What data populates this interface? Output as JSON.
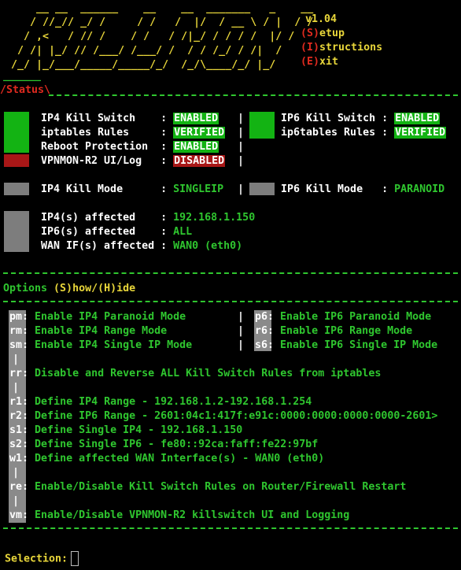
{
  "logo_art": "     __ __  ______    __    __  _______   _    __\n    / //_// _/ /     / /   /  |/  / __ \\ / |  / /\n   / ,<   / // /    / /   / /|_/ / / / /  |/ / \n  / /| |_/ // /___/ /___/ /  / / /_/ / /|  /  \n /_/ |_/___/_____/_____/_/  /_/\\____/_/ |_/   ",
  "menu": {
    "version": "v1.04",
    "setup_key": "(S)",
    "setup_label": "etup",
    "instr_key": "(I)",
    "instr_label": "structions",
    "exit_key": "(E)",
    "exit_label": "xit"
  },
  "status_underline": "______",
  "status_header": "/Status\\",
  "status": {
    "left": [
      {
        "label": "IP4 Kill Switch    :",
        "value": "ENABLED",
        "state": "green"
      },
      {
        "label": "iptables Rules     :",
        "value": "VERIFIED",
        "state": "green"
      },
      {
        "label": "Reboot Protection  :",
        "value": "ENABLED",
        "state": "green"
      },
      {
        "label": "VPNMON-R2 UI/Log   :",
        "value": "DISABLED",
        "state": "red"
      }
    ],
    "right": [
      {
        "label": "IP6 Kill Switch :",
        "value": "ENABLED",
        "state": "green"
      },
      {
        "label": "ip6tables Rules :",
        "value": "VERIFIED",
        "state": "green"
      }
    ],
    "ip4_mode_label": "IP4 Kill Mode      :",
    "ip4_mode_value": "SINGLEIP",
    "ip6_mode_label": "IP6 Kill Mode   :",
    "ip6_mode_value": "PARANOID",
    "affected": [
      {
        "label": "IP4(s) affected    :",
        "value": "192.168.1.150"
      },
      {
        "label": "IP6(s) affected    :",
        "value": "ALL"
      },
      {
        "label": "WAN IF(s) affected :",
        "value": "WAN0 (eth0)"
      }
    ]
  },
  "options_header": {
    "prefix": "Options ",
    "show": "(S)how/(H)ide"
  },
  "options": {
    "ip4": [
      {
        "key": "pm",
        "label": "Enable IP4 Paranoid Mode"
      },
      {
        "key": "rm",
        "label": "Enable IP4 Range Mode"
      },
      {
        "key": "sm",
        "label": "Enable IP4 Single IP Mode"
      }
    ],
    "ip6": [
      {
        "key": "p6",
        "label": "Enable IP6 Paranoid Mode"
      },
      {
        "key": "r6",
        "label": "Enable IP6 Range Mode"
      },
      {
        "key": "s6",
        "label": "Enable IP6 Single IP Mode"
      }
    ],
    "rr": {
      "key": "rr",
      "label": "Disable and Reverse ALL Kill Switch Rules from iptables"
    },
    "defines": [
      {
        "key": "r1",
        "label": "Define IP4 Range - 192.168.1.2-192.168.1.254"
      },
      {
        "key": "r2",
        "label": "Define IP6 Range - 2601:04c1:417f:e91c:0000:0000:0000:0000-2601>"
      },
      {
        "key": "s1",
        "label": "Define Single IP4 - 192.168.1.150"
      },
      {
        "key": "s2",
        "label": "Define Single IP6 - fe80::92ca:faff:fe22:97bf"
      },
      {
        "key": "w1",
        "label": "Define affected WAN Interface(s) - WAN0 (eth0)"
      }
    ],
    "re": {
      "key": "re",
      "label": "Enable/Disable Kill Switch Rules on Router/Firewall Restart"
    },
    "vm": {
      "key": "vm",
      "label": "Enable/Disable VPNMON-R2 killswitch UI and Logging"
    }
  },
  "prompt": {
    "label": "Selection:"
  },
  "colors": {
    "accent_green": "#13b313",
    "text_green": "#2fc62f",
    "yellow": "#e8d63a",
    "red": "#e02a1f",
    "key_grey": "#8a8a8a"
  }
}
